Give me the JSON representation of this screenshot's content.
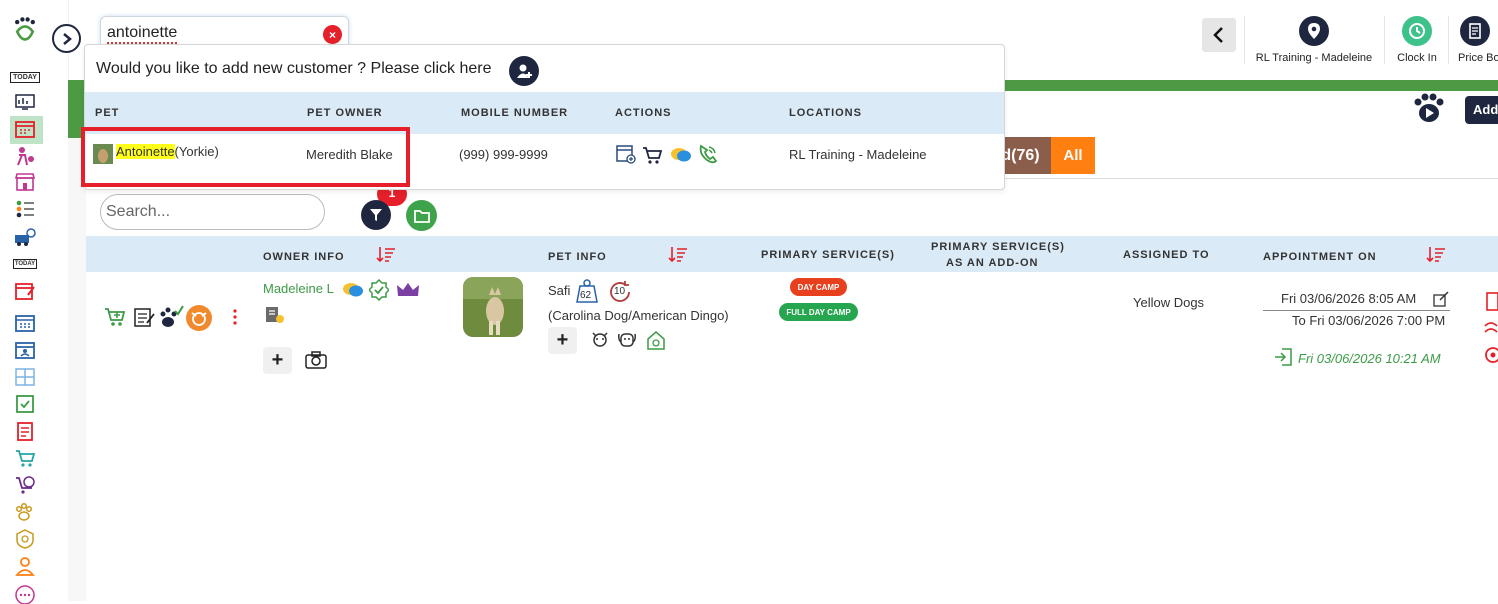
{
  "search": {
    "value": "antoinette"
  },
  "top_bar": {
    "location_label": "RL Training - Madeleine",
    "clock_in_label": "Clock In",
    "price_label": "Price Bo"
  },
  "rail": {
    "today_label": "TODAY",
    "today_label_2": "TODAY"
  },
  "dropdown": {
    "prompt": "Would you like to add new customer ? Please click here",
    "headers": {
      "pet": "PET",
      "owner": "PET OWNER",
      "mobile": "MOBILE NUMBER",
      "actions": "ACTIONS",
      "locations": "LOCATIONS"
    },
    "result": {
      "pet_name": "Antoinette",
      "pet_breed": "(Yorkie)",
      "owner": "Meredith Blake",
      "mobile": "(999) 999-9999",
      "location": "RL Training - Madeleine"
    }
  },
  "add_button_label": "Add",
  "tabs": {
    "partial_label": "d(76)",
    "all_label": "All"
  },
  "list": {
    "search_placeholder": "Search...",
    "filter_badge": "1",
    "headers": {
      "owner_info": "OWNER INFO",
      "pet_info": "PET INFO",
      "primary_services": "PRIMARY SERVICE(S)",
      "primary_addon_line1": "PRIMARY SERVICE(S)",
      "primary_addon_line2": "AS AN ADD-ON",
      "assigned_to": "ASSIGNED TO",
      "appointment_on": "APPOINTMENT ON"
    },
    "row": {
      "owner": "Madeleine L",
      "pet_name": "Safi",
      "weight_badge": "62",
      "age_badge": "10",
      "breed": "(Carolina Dog/American Dingo)",
      "services": [
        "DAY CAMP",
        "FULL DAY CAMP"
      ],
      "assigned": "Yellow Dogs",
      "appt_from": "Fri 03/06/2026 8:05 AM",
      "appt_to": "To Fri 03/06/2026 7:00 PM",
      "checkin": "Fri 03/06/2026 10:21 AM"
    }
  },
  "colors": {
    "brand_dark": "#1f2640",
    "green": "#4c9b44",
    "orange": "#ff7f11",
    "red": "#e5202a",
    "header_blue": "#dbeaf7"
  }
}
